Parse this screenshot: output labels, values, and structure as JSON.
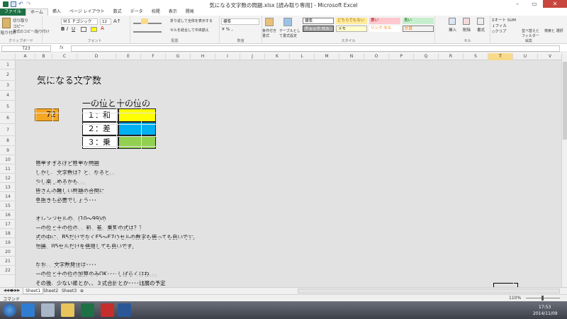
{
  "window": {
    "title": "気になる文字数の問題.xlsx [読み取り専用] - Microsoft Excel"
  },
  "tabs": [
    "ファイル",
    "ホーム",
    "挿入",
    "ページ レイアウト",
    "数式",
    "データ",
    "校閲",
    "表示",
    "開発"
  ],
  "ribbon": {
    "clipboard": {
      "paste": "貼り付け",
      "cut": "切り取り",
      "copy": "コピー",
      "format_painter": "書式のコピー/貼り付け",
      "label": "クリップボード"
    },
    "font": {
      "name": "ＭＳ Ｐゴシック",
      "size": "12",
      "label": "フォント"
    },
    "alignment": {
      "wrap": "折り返して全体を表示する",
      "merge": "セルを結合して中央揃え",
      "label": "配置"
    },
    "number": {
      "format": "標準",
      "label": "数値"
    },
    "styles": {
      "conditional": "条件付き書式",
      "table": "テーブルとして書式設定",
      "cells": [
        "標準",
        "どちらでもない",
        "悪い",
        "良い",
        "チェック セル",
        "メモ",
        "リンク セル",
        "計算"
      ],
      "label": "スタイル"
    },
    "cells": {
      "insert": "挿入",
      "delete": "削除",
      "format": "書式",
      "label": "セル"
    },
    "editing": {
      "autosum": "オート SUM",
      "fill": "フィル",
      "clear": "クリア",
      "sort": "並べ替えと フィルター",
      "find": "検索と 選択",
      "label": "編集"
    }
  },
  "formula_bar": {
    "namebox": "T23",
    "fx": "fx",
    "value": ""
  },
  "columns": [
    "A",
    "B",
    "C",
    "D",
    "E",
    "F",
    "G",
    "H",
    "I",
    "J",
    "K",
    "L",
    "M",
    "N",
    "O",
    "P",
    "Q",
    "R",
    "S",
    "T",
    "U",
    "V"
  ],
  "selected_column": "T",
  "rows": [
    "1",
    "2",
    "3",
    "4",
    "5",
    "6",
    "7",
    "8",
    "9",
    "10",
    "11",
    "12",
    "13",
    "14",
    "15",
    "16",
    "17",
    "18",
    "19",
    "20",
    "21",
    "22"
  ],
  "sheet": {
    "title": "気になる文字数",
    "subtitle": "一の位と十の位の",
    "number": "72",
    "options": [
      {
        "label": "１：和",
        "color": "#ffff00"
      },
      {
        "label": "２：差",
        "color": "#00b0f0"
      },
      {
        "label": "３：乗",
        "color": "#92d050"
      }
    ],
    "lines": [
      "簡単すぎるほど簡単な問題",
      "しかし、文字数は？と、なると、、",
      "少し楽しめるかも、、、",
      "皆さんの難しい問題の合間に",
      "息抜きも必要でしょう･･･",
      "",
      "オレンジセルの、(10～99)の",
      "一の位と十の位の、、和、差、乗算の式は？？",
      "式の中に、B5だけでなくE5～E7のセルの数字も使っても良いです。",
      "勿論、B5セルだけを使用しても良いです。",
      "",
      "なお、、文字数発言は････",
      "一の位と十の位の加算のみOK････しばらくはね、、、",
      "その後、少ない順とか、、３式合計とか････進展の予定"
    ]
  },
  "sheet_tabs": [
    "Sheet1",
    "Sheet2",
    "Sheet3"
  ],
  "status": {
    "mode": "コマンド",
    "zoom": "110%"
  },
  "taskbar": {
    "time": "17:53",
    "date": "2014/11/09"
  },
  "colors": {
    "orange_cell": "#f5a623",
    "excel_green": "#1e7145",
    "selected_header": "#f9d98a"
  }
}
